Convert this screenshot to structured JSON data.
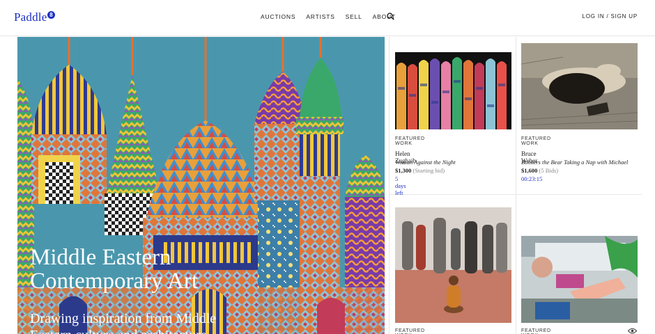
{
  "header": {
    "logo_text": "Paddle",
    "logo_badge": "8",
    "nav": [
      "AUCTIONS",
      "ARTISTS",
      "SELL",
      "ABOUT"
    ],
    "login": "LOG IN / SIGN UP",
    "brand_color": "#1d2fc4"
  },
  "hero": {
    "title": "Middle Eastern Contemporary Art",
    "subtitle": "Drawing inspiration from Middle Eastern culture and architecture",
    "background_color": "#4a97ad"
  },
  "cards": [
    {
      "label": "FEATURED WORK",
      "artist": "Helen Zughaib",
      "work": "Woman Against the Night",
      "price": "$1,300",
      "price_note": "(Starting bid)",
      "time": "5 days left"
    },
    {
      "label": "FEATURED WORK",
      "artist": "Bruce Weber",
      "work": "Bonkers the Bear Taking a Nap with Michael",
      "price": "$1,600",
      "price_note": "(5 Bids)",
      "time": "00:23:15"
    },
    {
      "label": "FEATURED WORK"
    },
    {
      "label": "FEATURED WORK"
    }
  ],
  "icons": {
    "search": "search-icon",
    "eye": "eye-icon"
  }
}
